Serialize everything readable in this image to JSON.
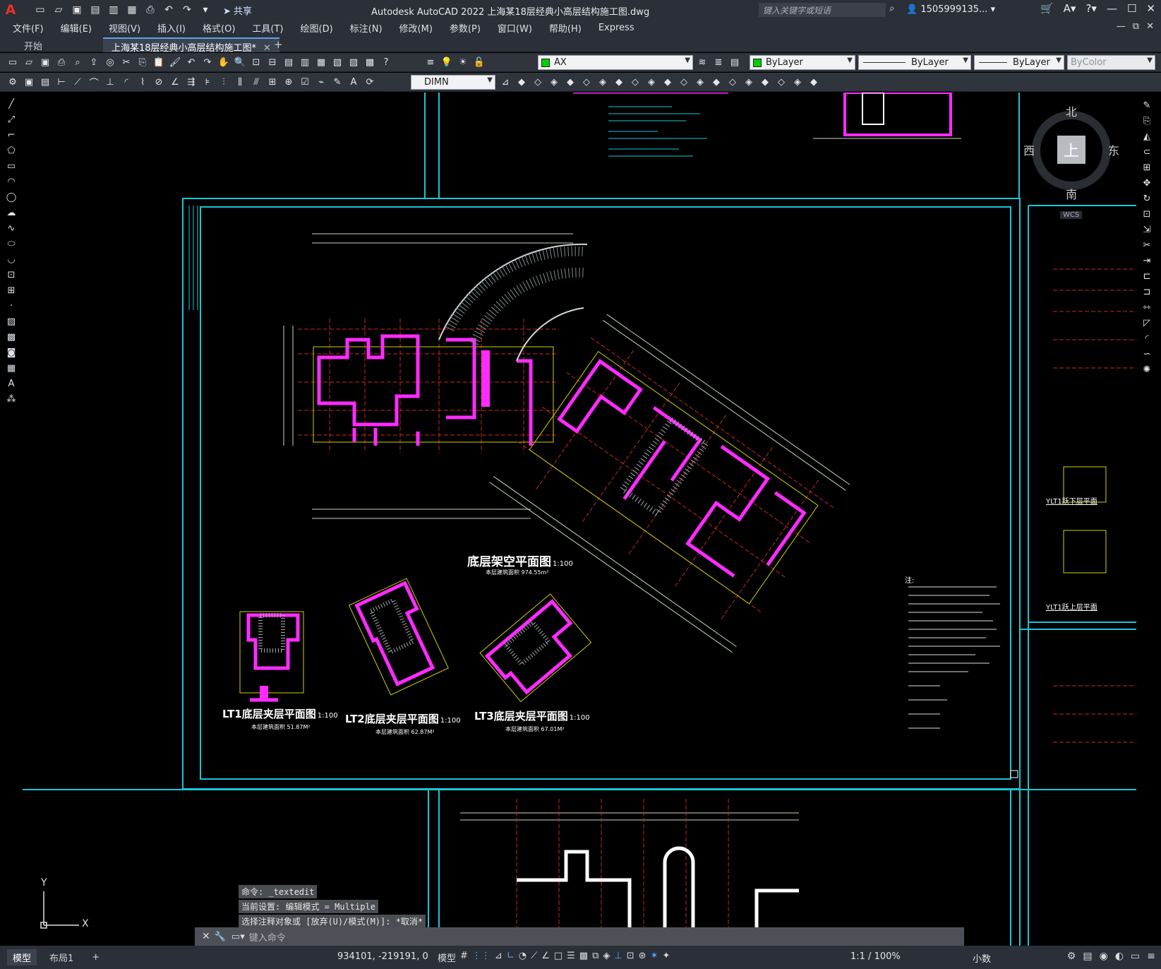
{
  "window": {
    "app_logo": "A",
    "title": "Autodesk AutoCAD 2022   上海某18层经典小高层结构施工图.dwg",
    "search_placeholder": "键入关键字或短语",
    "user": "1505999135...",
    "share_label": "共享"
  },
  "menu": [
    "文件(F)",
    "编辑(E)",
    "视图(V)",
    "插入(I)",
    "格式(O)",
    "工具(T)",
    "绘图(D)",
    "标注(N)",
    "修改(M)",
    "参数(P)",
    "窗口(W)",
    "帮助(H)",
    "Express"
  ],
  "tabs": [
    {
      "label": "开始",
      "active": false
    },
    {
      "label": "上海某18层经典小高层结构施工图*",
      "active": true
    }
  ],
  "toolbar": {
    "layer": "AX",
    "color": "ByLayer",
    "linetype": "ByLayer",
    "lineweight": "ByLayer",
    "plotstyle": "ByColor",
    "dimstyle": "DIMN",
    "layer_color": "#00d000"
  },
  "viewcube": {
    "north": "北",
    "south": "南",
    "east": "东",
    "west": "西",
    "top": "上",
    "wcs": "WCS"
  },
  "drawing": {
    "main_title": "底层架空平面图",
    "main_scale": "1:100",
    "main_area": "本层建筑面积 974.55m²",
    "lt1_title": "LT1底层夹层平面图",
    "lt1_scale": "1:100",
    "lt1_area": "本层建筑面积   51.87M²",
    "lt2_title": "LT2底层夹层平面图",
    "lt2_scale": "1:100",
    "lt2_area": "本层建筑面积   62.87M²",
    "lt3_title": "LT3底层夹层平面图",
    "lt3_scale": "1:100",
    "lt3_area": "本层建筑面积   67.01M²",
    "notes_title": "注:",
    "side_label_1": "YLT1跃下层平面",
    "side_label_2": "YLT1跃上层平面"
  },
  "ucs": {
    "x": "X",
    "y": "Y"
  },
  "command": {
    "history": [
      "命令: _textedit",
      "当前设置: 编辑模式 = Multiple",
      "选择注释对象或 [放弃(U)/模式(M)]: *取消*"
    ],
    "placeholder": "键入命令"
  },
  "status": {
    "model_tab": "模型",
    "layout_tab": "布局1",
    "add_tab": "+",
    "coords": "934101, -219191, 0",
    "space": "模型",
    "annotation_scale": "1:1 / 100%",
    "units": "小数"
  }
}
